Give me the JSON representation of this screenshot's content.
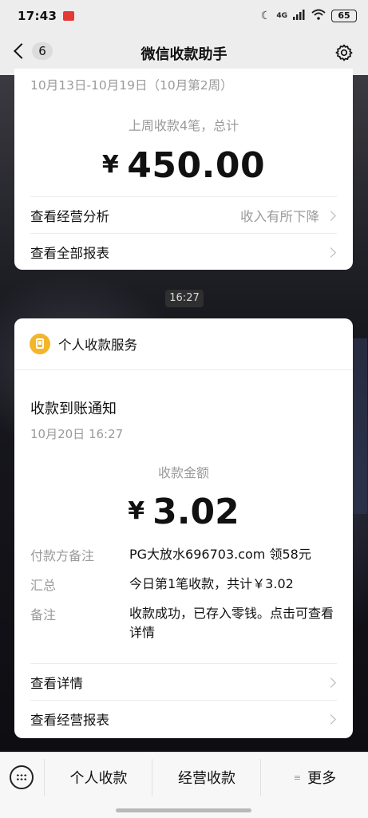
{
  "status_bar": {
    "time": "17:43",
    "network": "4G",
    "battery": "65"
  },
  "nav": {
    "back_count": "6",
    "title": "微信收款助手"
  },
  "weekly_card": {
    "period": "10月13日-10月19日（10月第2周）",
    "summary": "上周收款4笔，总计",
    "currency": "¥",
    "amount": "450.00",
    "rows": [
      {
        "label": "查看经营分析",
        "value": "收入有所下降"
      },
      {
        "label": "查看全部报表",
        "value": ""
      }
    ]
  },
  "timestamp": "16:27",
  "payment_card": {
    "service_name": "个人收款服务",
    "title": "收款到账通知",
    "date": "10月20日 16:27",
    "amount_label": "收款金额",
    "currency": "¥",
    "amount": "3.02",
    "details": [
      {
        "key": "付款方备注",
        "value": "PG大放水696703.com 领58元"
      },
      {
        "key": "汇总",
        "value": "今日第1笔收款，共计￥3.02"
      },
      {
        "key": "备注",
        "value": "收款成功，已存入零钱。点击可查看详情"
      }
    ],
    "rows": [
      {
        "label": "查看详情"
      },
      {
        "label": "查看经营报表"
      }
    ]
  },
  "bottom_menu": {
    "items": [
      "个人收款",
      "经营收款",
      "更多"
    ]
  }
}
